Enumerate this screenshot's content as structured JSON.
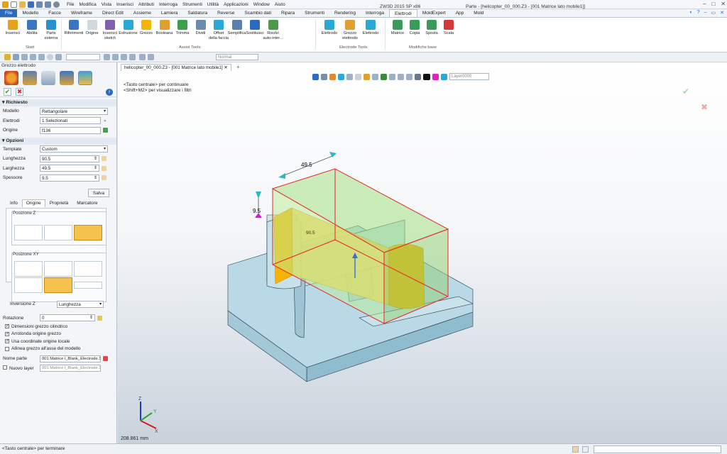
{
  "titlebar": {
    "menus": [
      "File",
      "Modifica",
      "Vista",
      "Inserisci",
      "Attributi",
      "Interroga",
      "Strumenti",
      "Utilità",
      "Applicazioni",
      "Window",
      "Aiuto"
    ],
    "app_name": "ZW3D 2015 SP x86",
    "doc_title": "Parte - [helicopter_00_000.Z3 - [001 Matrice lato mobile1]]"
  },
  "ribbon_tabs": [
    "File",
    "Modello",
    "Facce",
    "Wireframe",
    "Direct Edit",
    "Assieme",
    "Lamiera",
    "Saldatura",
    "Reverse",
    "Scambio dati",
    "Ripara",
    "Strumenti",
    "Rendering",
    "Interroga",
    "Elettrodi",
    "MoldExpert",
    "App",
    "Mold"
  ],
  "active_tab": "Elettrodi",
  "ribbon": {
    "start": {
      "label": "Start",
      "buttons": [
        "Inserisci",
        "Abilita",
        "Parte esterna"
      ]
    },
    "assist": {
      "label": "Assist Tools",
      "buttons": [
        "Riferimenti",
        "Origine",
        "Inserisci sketch",
        "Estrusione",
        "Grezzo",
        "Booleana",
        "Trimma",
        "Dividi",
        "Offset della faccia",
        "Semplifica",
        "Sostituisci",
        "Risolvi auto-inter..."
      ]
    },
    "electrode": {
      "label": "Electrode Tools",
      "buttons": [
        "Elettrodo",
        "Grezzo elettrodo",
        "Elettrodo"
      ]
    },
    "modifiche": {
      "label": "Modifiche base",
      "buttons": [
        "Matrice",
        "Copia",
        "Sposta",
        "Scala"
      ]
    }
  },
  "toolbar2": {
    "filter_value": "",
    "mode_value": "Normal"
  },
  "panel": {
    "title": "Grezzo elettrodo",
    "richiesto": {
      "header": "Richiesto",
      "modello_label": "Modello",
      "modello_value": "Rettangolare",
      "elettrodi_label": "Elettrodi",
      "elettrodi_value": "1 Selezionati",
      "origine_label": "Origine",
      "origine_value": "f136"
    },
    "opzioni": {
      "header": "Opzioni",
      "template_label": "Template",
      "template_value": "Custom",
      "lunghezza_label": "Lunghezza",
      "lunghezza_value": "90.5",
      "larghezza_label": "Larghezza",
      "larghezza_value": "49.5",
      "spessore_label": "Spessore",
      "spessore_value": "9.5",
      "salva": "Salva"
    },
    "subtabs": [
      "Info",
      "Origine",
      "Proprietà",
      "Marcatore"
    ],
    "active_subtab": "Origine",
    "posizione_z": "Posizione Z",
    "posizione_xy": "Posizione XY",
    "inversione_label": "Inversione Z",
    "inversione_value": "Lunghezza",
    "rotazione_label": "Rotazione",
    "rotazione_value": "0",
    "checks": [
      {
        "label": "Dimensioni grezzo cilindrico",
        "checked": true
      },
      {
        "label": "Arrotonda origine grezzo",
        "checked": true
      },
      {
        "label": "Usa coordinate origine locale",
        "checked": true
      },
      {
        "label": "Allinea grezzo all'asse del modello",
        "checked": false
      }
    ],
    "nome_parte_label": "Nome parte",
    "nome_parte_value": "001 Matrice l_Blank_Electrode.1",
    "nuovo_layer_label": "Nuovo layer",
    "nuovo_layer_value": "001 Matrice l_Blank_Electrode.1"
  },
  "view": {
    "doc_tab": "helicopter_00_000.Z3 - [001 Matrice lato mobile1]",
    "hint1": "<Tasto centrale> per continuare",
    "hint2": "<Shift+M2> per visualizzare i filtri",
    "layer": "Layer0000",
    "dim_width": "49.5",
    "dim_height": "9.5",
    "dim_length": "90.5",
    "scale": "208.861 mm",
    "axes": {
      "x": "X",
      "y": "Y",
      "z": "Z"
    }
  },
  "status": {
    "text": "<Tasto centrale> per terminare"
  },
  "colors": {
    "accent": "#2a6bbf",
    "electrode_orange": "#f5b400",
    "blank_green": "#9be07a",
    "part_blue": "#bcdce8",
    "edge_red": "#e8262b"
  }
}
